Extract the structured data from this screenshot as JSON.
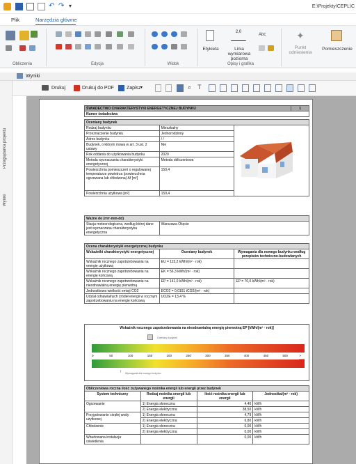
{
  "window": {
    "path": "E:\\Projekty\\CEPL\\C"
  },
  "tabs": [
    {
      "label": "Plik"
    },
    {
      "label": "Narzędzia główne"
    }
  ],
  "ribbon": {
    "groups": {
      "obliczenia": "Obliczenia",
      "edycja": "Edycja",
      "widok": "Widok",
      "opisy": "Opisy i grafika"
    },
    "buttons": {
      "etykieta": "Etykieta",
      "linia1": "Linia wymiarowa",
      "linia2": "pozioma",
      "linia_num": "2,0",
      "punkt1": "Punkt",
      "punkt2": "odniesienia",
      "pomieszczenie": "Pomieszczenie",
      "abc": "Abc"
    }
  },
  "panel": {
    "title": "Wyniki",
    "side_tab1": "Przeglądarka projektu",
    "side_tab2": "Wyniki"
  },
  "toolbar": {
    "print": "Drukuj",
    "print_pdf": "Drukuj do PDF",
    "save": "Zapisz"
  },
  "document": {
    "title": "ŚWIADECTWO CHARAKTERYSTYKI ENERGETYCZNEJ BUDYNKU",
    "page_no": "1",
    "cert_no_label": "Numer świadectwa",
    "section1": "Oceniany budynek",
    "rows1": [
      {
        "k": "Rodzaj budynku",
        "v": "Mieszkalny"
      },
      {
        "k": "Przeznaczenie budynku",
        "v": "Jednorodzinny"
      },
      {
        "k": "Adres budynku",
        "v": "/ /"
      },
      {
        "k": "Budynek, o którym mowa w art. 3 ust. 2 ustawy",
        "v": "Nie"
      },
      {
        "k": "Rok oddania do użytkowania budynku",
        "v": "2020"
      },
      {
        "k": "Metoda wyznaczania charakterystyki energetycznej",
        "v": "Metoda obliczeniowa"
      },
      {
        "k": "Powierzchnia pomieszczeń o regulowanej temperaturze powietrza (powierzchnia ogrzewana lub chłodzona) Af [m²]",
        "v": "150,4"
      },
      {
        "k": "Powierzchnia użytkowa [m²]",
        "v": "150,4"
      }
    ],
    "valid_label": "Ważne do (rrrr-mm-dd)",
    "station_label": "Stacja meteorologiczna, według której dane jest wyznaczana charakterystyka energetyczna",
    "station_value": "Warszawa Okęcie",
    "section2": "Ocena charakterystyki energetycznej budynku",
    "col_a": "Wskaźniki charakterystyki energetycznej",
    "col_b": "Oceniany budynek",
    "col_c": "Wymagania dla nowego budynku według przepisów techniczno-budowlanych",
    "rows2": [
      {
        "k": "Wskaźnik rocznego zapotrzebowania na energię użytkową",
        "v": "EU = 115,2 kWh/(m² · rok)",
        "r": ""
      },
      {
        "k": "Wskaźnik rocznego zapotrzebowania na energię końcową",
        "v": "EK = 56,3 kWh/(m² · rok)",
        "r": ""
      },
      {
        "k": "Wskaźnik rocznego zapotrzebowania na nieodnawialną energię pierwotną",
        "v": "EP = 141,0 kWh/(m² · rok)",
        "r": "EP = 70,0 kWh/(m² · rok)"
      },
      {
        "k": "Jednostkowa wielkość emisji CO2",
        "v": "ECO2 = 0,0151 tCO2/(m² · rok)",
        "r": ""
      },
      {
        "k": "Udział odnawialnych źródeł energii w rocznym zapotrzebowaniu na energię końcową",
        "v": "UOZE = 13,4 %",
        "r": ""
      }
    ],
    "scale_title": "Wskaźnik rocznego zapotrzebowania na nieodnawialną energię pierwotną EP [kWh/(m² · rok)]",
    "scale_marker_top": "Oceniany budynek",
    "scale_marker_bottom": "Wymagania dla nowego budynku",
    "scale_ticks": [
      "0",
      "50",
      "100",
      "150",
      "200",
      "250",
      "300",
      "350",
      "400",
      "450",
      "500",
      "> 500"
    ],
    "section3": "Obliczeniowa roczna ilość zużywanego nośnika energii lub energii przez budynek",
    "col3_a": "System techniczny",
    "col3_b": "Rodzaj nośnika energii lub energii",
    "col3_c": "Ilość nośnika energii lub energii",
    "col3_d": "Jednostka/(m² · rok)",
    "rows3": [
      {
        "sys": "Ogrzewanie",
        "carrier": "1) Energia słoneczna",
        "val": "4,40",
        "unit": "kWh"
      },
      {
        "sys": "",
        "carrier": "2) Energia elektryczna",
        "val": "38,50",
        "unit": "kWh"
      },
      {
        "sys": "Przygotowanie ciepłej wody użytkowej",
        "carrier": "1) Energia słoneczna",
        "val": "4,79",
        "unit": "kWh"
      },
      {
        "sys": "",
        "carrier": "2) Energia elektryczna",
        "val": "6,80",
        "unit": "kWh"
      },
      {
        "sys": "Chłodzenie",
        "carrier": "1) Energia słoneczna",
        "val": "0,00",
        "unit": "kWh"
      },
      {
        "sys": "",
        "carrier": "2) Energia elektryczna",
        "val": "0,00",
        "unit": "kWh"
      },
      {
        "sys": "Wbudowana instalacja oświetlenia",
        "carrier": "",
        "val": "0,00",
        "unit": "kWh"
      }
    ]
  }
}
